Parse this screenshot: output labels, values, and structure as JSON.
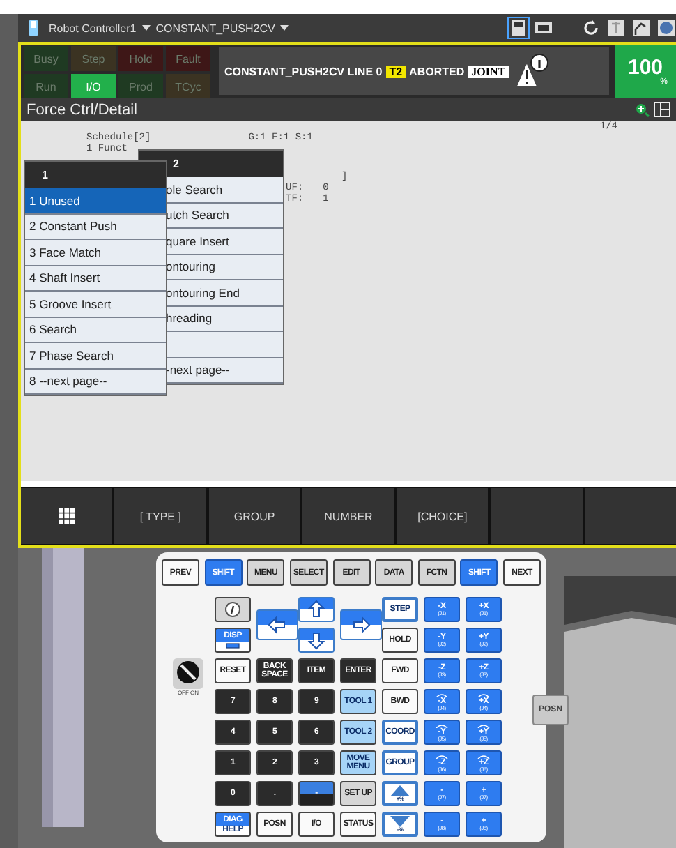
{
  "toolbar": {
    "controller": "Robot Controller1",
    "program": "CONSTANT_PUSH2CV"
  },
  "status_lamps": [
    {
      "label": "Busy",
      "on": false,
      "color": "#1f3a22"
    },
    {
      "label": "Step",
      "on": false,
      "color": "#3b3322"
    },
    {
      "label": "Hold",
      "on": false,
      "color": "#3e1717"
    },
    {
      "label": "Fault",
      "on": false,
      "color": "#3e1717"
    },
    {
      "label": "Run",
      "on": false,
      "color": "#1f3a22"
    },
    {
      "label": "I/O",
      "on": true,
      "color": "#22b04b"
    },
    {
      "label": "Prod",
      "on": false,
      "color": "#1f3a22"
    },
    {
      "label": "TCyc",
      "on": false,
      "color": "#3b3322"
    }
  ],
  "status_line": {
    "program": "CONSTANT_PUSH2CV LINE 0",
    "mode": "T2",
    "state": "ABORTED",
    "coord": "JOINT"
  },
  "override": {
    "value": "100",
    "unit": "%"
  },
  "screen_title": "Force Ctrl/Detail",
  "detail": {
    "page": "1/4",
    "schedule": "Schedule[2]",
    "gfs": "G:1 F:1 S:1",
    "function_label": "1 Funct",
    "bracket": "]",
    "uf_label": "UF:",
    "uf": "0",
    "tf_label": "TF:",
    "tf": "1"
  },
  "back_menu": {
    "header": "2",
    "items": [
      {
        "kind": "option",
        "label": "ole Search"
      },
      {
        "kind": "option",
        "label": "utch Search"
      },
      {
        "kind": "option",
        "label": "quare Insert"
      },
      {
        "kind": "option",
        "label": "ontouring"
      },
      {
        "kind": "option",
        "label": "ontouring End"
      },
      {
        "kind": "option",
        "label": "hreading"
      },
      {
        "kind": "blank"
      },
      {
        "kind": "option",
        "label": "-next page--"
      }
    ]
  },
  "front_menu": {
    "header": "1",
    "items": [
      {
        "label": "1 Unused",
        "selected": true
      },
      {
        "label": "2 Constant Push",
        "selected": false
      },
      {
        "label": "3 Face Match",
        "selected": false
      },
      {
        "label": "4 Shaft Insert",
        "selected": false
      },
      {
        "label": "5 Groove Insert",
        "selected": false
      },
      {
        "label": "6 Search",
        "selected": false
      },
      {
        "label": "7 Phase Search",
        "selected": false
      },
      {
        "label": "8 --next page--",
        "selected": false
      }
    ]
  },
  "function_keys": [
    {
      "kind": "grid"
    },
    {
      "kind": "label",
      "label": "[ TYPE ]"
    },
    {
      "kind": "label",
      "label": "GROUP"
    },
    {
      "kind": "label",
      "label": "NUMBER"
    },
    {
      "kind": "label",
      "label": "[CHOICE]"
    },
    {
      "kind": "blank"
    },
    {
      "kind": "blank"
    }
  ],
  "keypad": {
    "switch_label": "OFF ON",
    "side_key": "POSN",
    "top_row": [
      {
        "kind": "nav",
        "label": "PREV"
      },
      {
        "kind": "shift",
        "label": "SHIFT"
      },
      {
        "kind": "function",
        "label": "MENU"
      },
      {
        "kind": "function",
        "label": "SELECT"
      },
      {
        "kind": "function",
        "label": "EDIT"
      },
      {
        "kind": "function",
        "label": "DATA"
      },
      {
        "kind": "function",
        "label": "FCTN"
      },
      {
        "kind": "shift",
        "label": "SHIFT"
      },
      {
        "kind": "nav",
        "label": "NEXT"
      }
    ],
    "keys": [
      {
        "kind": "info"
      },
      {
        "kind": "left"
      },
      {
        "kind": "up"
      },
      {
        "kind": "right"
      },
      {
        "kind": "motion",
        "label": "STEP"
      },
      {
        "kind": "jog",
        "label": "-X",
        "sub": "(J1)",
        "rotation": false
      },
      {
        "kind": "jog",
        "label": "+X",
        "sub": "(J1)",
        "rotation": false
      },
      {
        "kind": "dual",
        "label": "DISP"
      },
      {
        "kind": "down"
      },
      {
        "kind": "nav",
        "label": "HOLD"
      },
      {
        "kind": "jog",
        "label": "-Y",
        "sub": "(J2)",
        "rotation": false
      },
      {
        "kind": "jog",
        "label": "+Y",
        "sub": "(J2)",
        "rotation": false
      },
      {
        "kind": "nav",
        "label": "RESET"
      },
      {
        "kind": "numeric",
        "label": "BACK SPACE"
      },
      {
        "kind": "numeric",
        "label": "ITEM"
      },
      {
        "kind": "numeric",
        "label": "ENTER"
      },
      {
        "kind": "nav",
        "label": "FWD"
      },
      {
        "kind": "jog",
        "label": "-Z",
        "sub": "(J3)",
        "rotation": false
      },
      {
        "kind": "jog",
        "label": "+Z",
        "sub": "(J3)",
        "rotation": false
      },
      {
        "kind": "numeric",
        "label": "7"
      },
      {
        "kind": "numeric",
        "label": "8"
      },
      {
        "kind": "numeric",
        "label": "9"
      },
      {
        "kind": "tool",
        "label": "TOOL 1"
      },
      {
        "kind": "nav",
        "label": "BWD"
      },
      {
        "kind": "jog",
        "label": "-X",
        "sub": "(J4)",
        "rotation": true
      },
      {
        "kind": "jog",
        "label": "+X",
        "sub": "(J4)",
        "rotation": true
      },
      {
        "kind": "numeric",
        "label": "4"
      },
      {
        "kind": "numeric",
        "label": "5"
      },
      {
        "kind": "numeric",
        "label": "6"
      },
      {
        "kind": "tool",
        "label": "TOOL 2"
      },
      {
        "kind": "motion",
        "label": "COORD"
      },
      {
        "kind": "jog",
        "label": "-Y",
        "sub": "(J5)",
        "rotation": true
      },
      {
        "kind": "jog",
        "label": "+Y",
        "sub": "(J5)",
        "rotation": true
      },
      {
        "kind": "numeric",
        "label": "1"
      },
      {
        "kind": "numeric",
        "label": "2"
      },
      {
        "kind": "numeric",
        "label": "3"
      },
      {
        "kind": "tool",
        "label": "MOVE MENU"
      },
      {
        "kind": "motion",
        "label": "GROUP"
      },
      {
        "kind": "jog",
        "label": "-Z",
        "sub": "(J6)",
        "rotation": true
      },
      {
        "kind": "jog",
        "label": "+Z",
        "sub": "(J6)",
        "rotation": true
      },
      {
        "kind": "numeric",
        "label": "0"
      },
      {
        "kind": "numeric",
        "label": "."
      },
      {
        "kind": "sign",
        "label": "-"
      },
      {
        "kind": "function",
        "label": "SET UP"
      },
      {
        "kind": "faster",
        "label": "+%"
      },
      {
        "kind": "jog",
        "label": "-",
        "sub": "(J7)",
        "rotation": false
      },
      {
        "kind": "jog",
        "label": "+",
        "sub": "(J7)",
        "rotation": false
      },
      {
        "kind": "dual",
        "label": "DIAG",
        "sub": "HELP"
      },
      {
        "kind": "nav",
        "label": "POSN"
      },
      {
        "kind": "nav",
        "label": "I/O"
      },
      {
        "kind": "nav",
        "label": "STATUS"
      },
      {
        "kind": "slower",
        "label": "-%"
      },
      {
        "kind": "jog",
        "label": "-",
        "sub": "(J8)",
        "rotation": false
      },
      {
        "kind": "jog",
        "label": "+",
        "sub": "(J8)",
        "rotation": false
      }
    ]
  }
}
